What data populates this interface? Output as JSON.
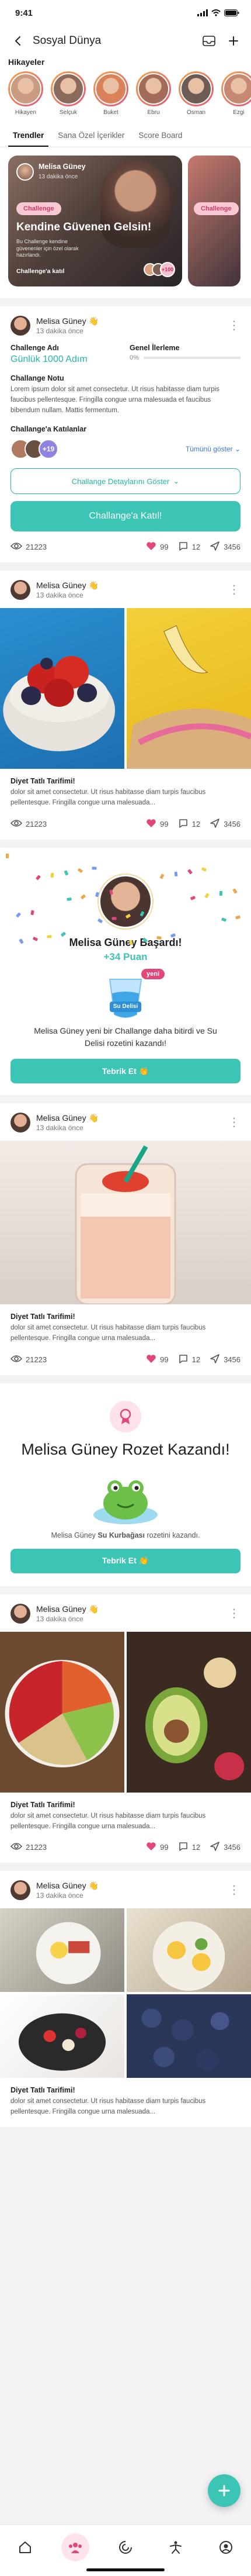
{
  "status_bar": {
    "time": "9:41"
  },
  "header": {
    "title": "Sosyal Dünya"
  },
  "stories": {
    "title": "Hikayeler",
    "items": [
      {
        "name": "Hikayen",
        "color": "#c99b80"
      },
      {
        "name": "Selçuk",
        "color": "#8a6a5a"
      },
      {
        "name": "Buket",
        "color": "#d9825a"
      },
      {
        "name": "Ebru",
        "color": "#a36b5a"
      },
      {
        "name": "Osman",
        "color": "#6d5c55"
      },
      {
        "name": "Ezgi",
        "color": "#c48873"
      }
    ]
  },
  "tabs": [
    "Trendler",
    "Sana Özel İçerikler",
    "Score Board"
  ],
  "hero": {
    "user": "Melisa Güney",
    "time": "13 dakika önce",
    "tag": "Challenge",
    "title": "Kendine Güvenen Gelsin!",
    "text": "Bu Challenge kendine güvenenler için özel olarak hazırlandı.",
    "join": "Challenge'a katıl",
    "count": "+100",
    "peek_tag": "Challenge"
  },
  "challenge_card": {
    "user": "Melisa Güney",
    "time": "13 dakika önce",
    "name_label": "Challenge Adı",
    "name": "Günlük 1000 Adım",
    "progress_label": "Genel İlerleme",
    "progress": "0%",
    "progress_value": 0.0,
    "note_label": "Challange Notu",
    "note": "Lorem ipsum dolor sit amet consectetur. Ut risus habitasse diam turpis faucibus pellentesque. Fringilla congue urna malesuada et faucibus bibendum nullam. Mattis fermentum.",
    "joined_label": "Challange'a Katılanlar",
    "joined_more": "+19",
    "show_all": "Tümünü göster",
    "details_btn": "Challange Detaylarını Göster",
    "join_btn": "Challange'a Katıl!",
    "views": "21223",
    "likes": "99",
    "comments": "12",
    "shares": "3456"
  },
  "post1": {
    "user": "Melisa Güney",
    "time": "13 dakika önce",
    "title": "Diyet Tatlı Tarifimi!",
    "text": "dolor sit amet consectetur. Ut risus habitasse diam turpis faucibus pellentesque. Fringilla congue urna malesuada...",
    "views": "21223",
    "likes": "99",
    "comments": "12",
    "shares": "3456"
  },
  "achievement": {
    "title": "Melisa Güney Başardı!",
    "points": "+34 Puan",
    "badge_new": "yeni",
    "badge_label": "Su Delisi",
    "message": "Melisa Güney yeni bir Challange daha bitirdi ve Su Delisi rozetini kazandı!",
    "button": "Tebrik Et 👏"
  },
  "post2": {
    "user": "Melisa Güney",
    "time": "13 dakika önce",
    "title": "Diyet Tatlı Tarifimi!",
    "text": "dolor sit amet consectetur. Ut risus habitasse diam turpis faucibus pellentesque. Fringilla congue urna malesuada...",
    "views": "21223",
    "likes": "99",
    "comments": "12",
    "shares": "3456"
  },
  "badge_card": {
    "title": "Melisa Güney Rozet Kazandı!",
    "message_pre": "Melisa Güney",
    "message_badge": "Su Kurbağası",
    "message_post": "rozetini kazandı.",
    "button": "Tebrik Et 👏"
  },
  "post3": {
    "user": "Melisa Güney",
    "time": "13 dakika önce",
    "title": "Diyet Tatlı Tarifimi!",
    "text": "dolor sit amet consectetur. Ut risus habitasse diam turpis faucibus pellentesque. Fringilla congue urna malesuada...",
    "views": "21223",
    "likes": "99",
    "comments": "12",
    "shares": "3456"
  },
  "post4": {
    "user": "Melisa Güney",
    "time": "13 dakika önce",
    "title": "Diyet Tatlı Tarifimi!",
    "text": "dolor sit amet consectetur. Ut risus habitasse diam turpis faucibus pellentesque. Fringilla congue urna malesuada..."
  },
  "colors": {
    "accent": "#3cc4b4",
    "like": "#e0487a",
    "link": "#3b77d8",
    "tag": "#d03866"
  }
}
